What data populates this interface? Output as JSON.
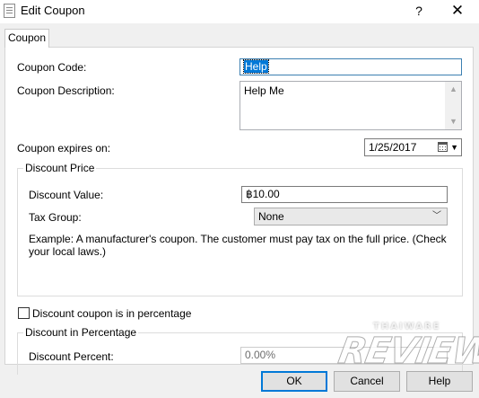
{
  "window": {
    "title": "Edit Coupon",
    "help_glyph": "?",
    "close_glyph": "✕"
  },
  "tabs": [
    {
      "label": "Coupon"
    }
  ],
  "form": {
    "coupon_code_label": "Coupon Code:",
    "coupon_code_value": "Help",
    "coupon_description_label": "Coupon Description:",
    "coupon_description_value": "Help Me",
    "expires_label": "Coupon expires on:",
    "expires_value": "1/25/2017"
  },
  "discount_price": {
    "group_title": "Discount Price",
    "value_label": "Discount Value:",
    "value": "฿10.00",
    "tax_group_label": "Tax Group:",
    "tax_group_value": "None",
    "example_text": "Example: A manufacturer's coupon.  The customer must pay tax on the full price.  (Check your local laws.)"
  },
  "percentage_checkbox": {
    "label": "Discount coupon is in percentage",
    "checked": false
  },
  "discount_percentage": {
    "group_title": "Discount in Percentage",
    "percent_label": "Discount Percent:",
    "percent_value": "0.00%"
  },
  "buttons": {
    "ok": "OK",
    "cancel": "Cancel",
    "help": "Help"
  },
  "watermark": {
    "small": "THAIWARE",
    "big": "REVIEW"
  },
  "colors": {
    "selection": "#0078d7",
    "dialog_bg": "#f0f0f0",
    "panel_bg": "#ffffff"
  }
}
